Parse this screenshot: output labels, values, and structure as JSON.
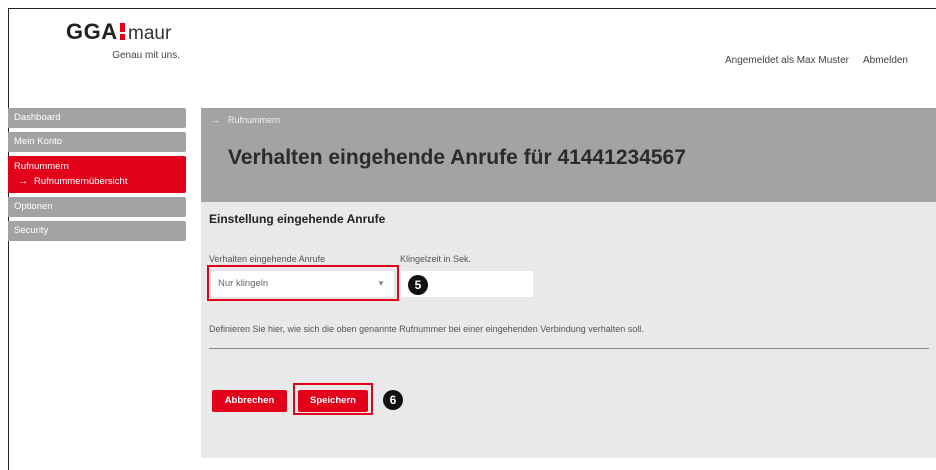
{
  "brand": {
    "logo_main": "GGA",
    "logo_sub": "maur",
    "tagline": "Genau mit uns.",
    "accent_color": "#e2001a",
    "sidebar_gray": "#a3a3a3"
  },
  "user": {
    "logged_in_text": "Angemeldet als Max Muster",
    "logout_label": "Abmelden"
  },
  "sidebar": {
    "items": [
      {
        "label": "Dashboard"
      },
      {
        "label": "Mein Konto"
      },
      {
        "label": "Rufnummern",
        "sub_label": "Rufnummernübersicht",
        "icon": "arrow-right-icon"
      },
      {
        "label": "Optionen"
      },
      {
        "label": "Security"
      }
    ]
  },
  "breadcrumb": {
    "icon": "arrow-right-icon",
    "label": "Rufnummern"
  },
  "page": {
    "title": "Verhalten eingehende Anrufe für 41441234567"
  },
  "form": {
    "section_title": "Einstellung eingehende Anrufe",
    "mode_label": "Verhalten eingehende Anrufe",
    "mode_value": "Nur klingeln",
    "ring_label": "Klingelzeit in Sek.",
    "ring_value": "",
    "help_text": "Definieren Sie hier, wie sich die oben genannte Rufnummer bei einer eingehenden Verbindung verhalten soll.",
    "cancel_label": "Abbrechen",
    "save_label": "Speichern"
  },
  "annotations": {
    "step_select": "5",
    "step_save": "6"
  }
}
